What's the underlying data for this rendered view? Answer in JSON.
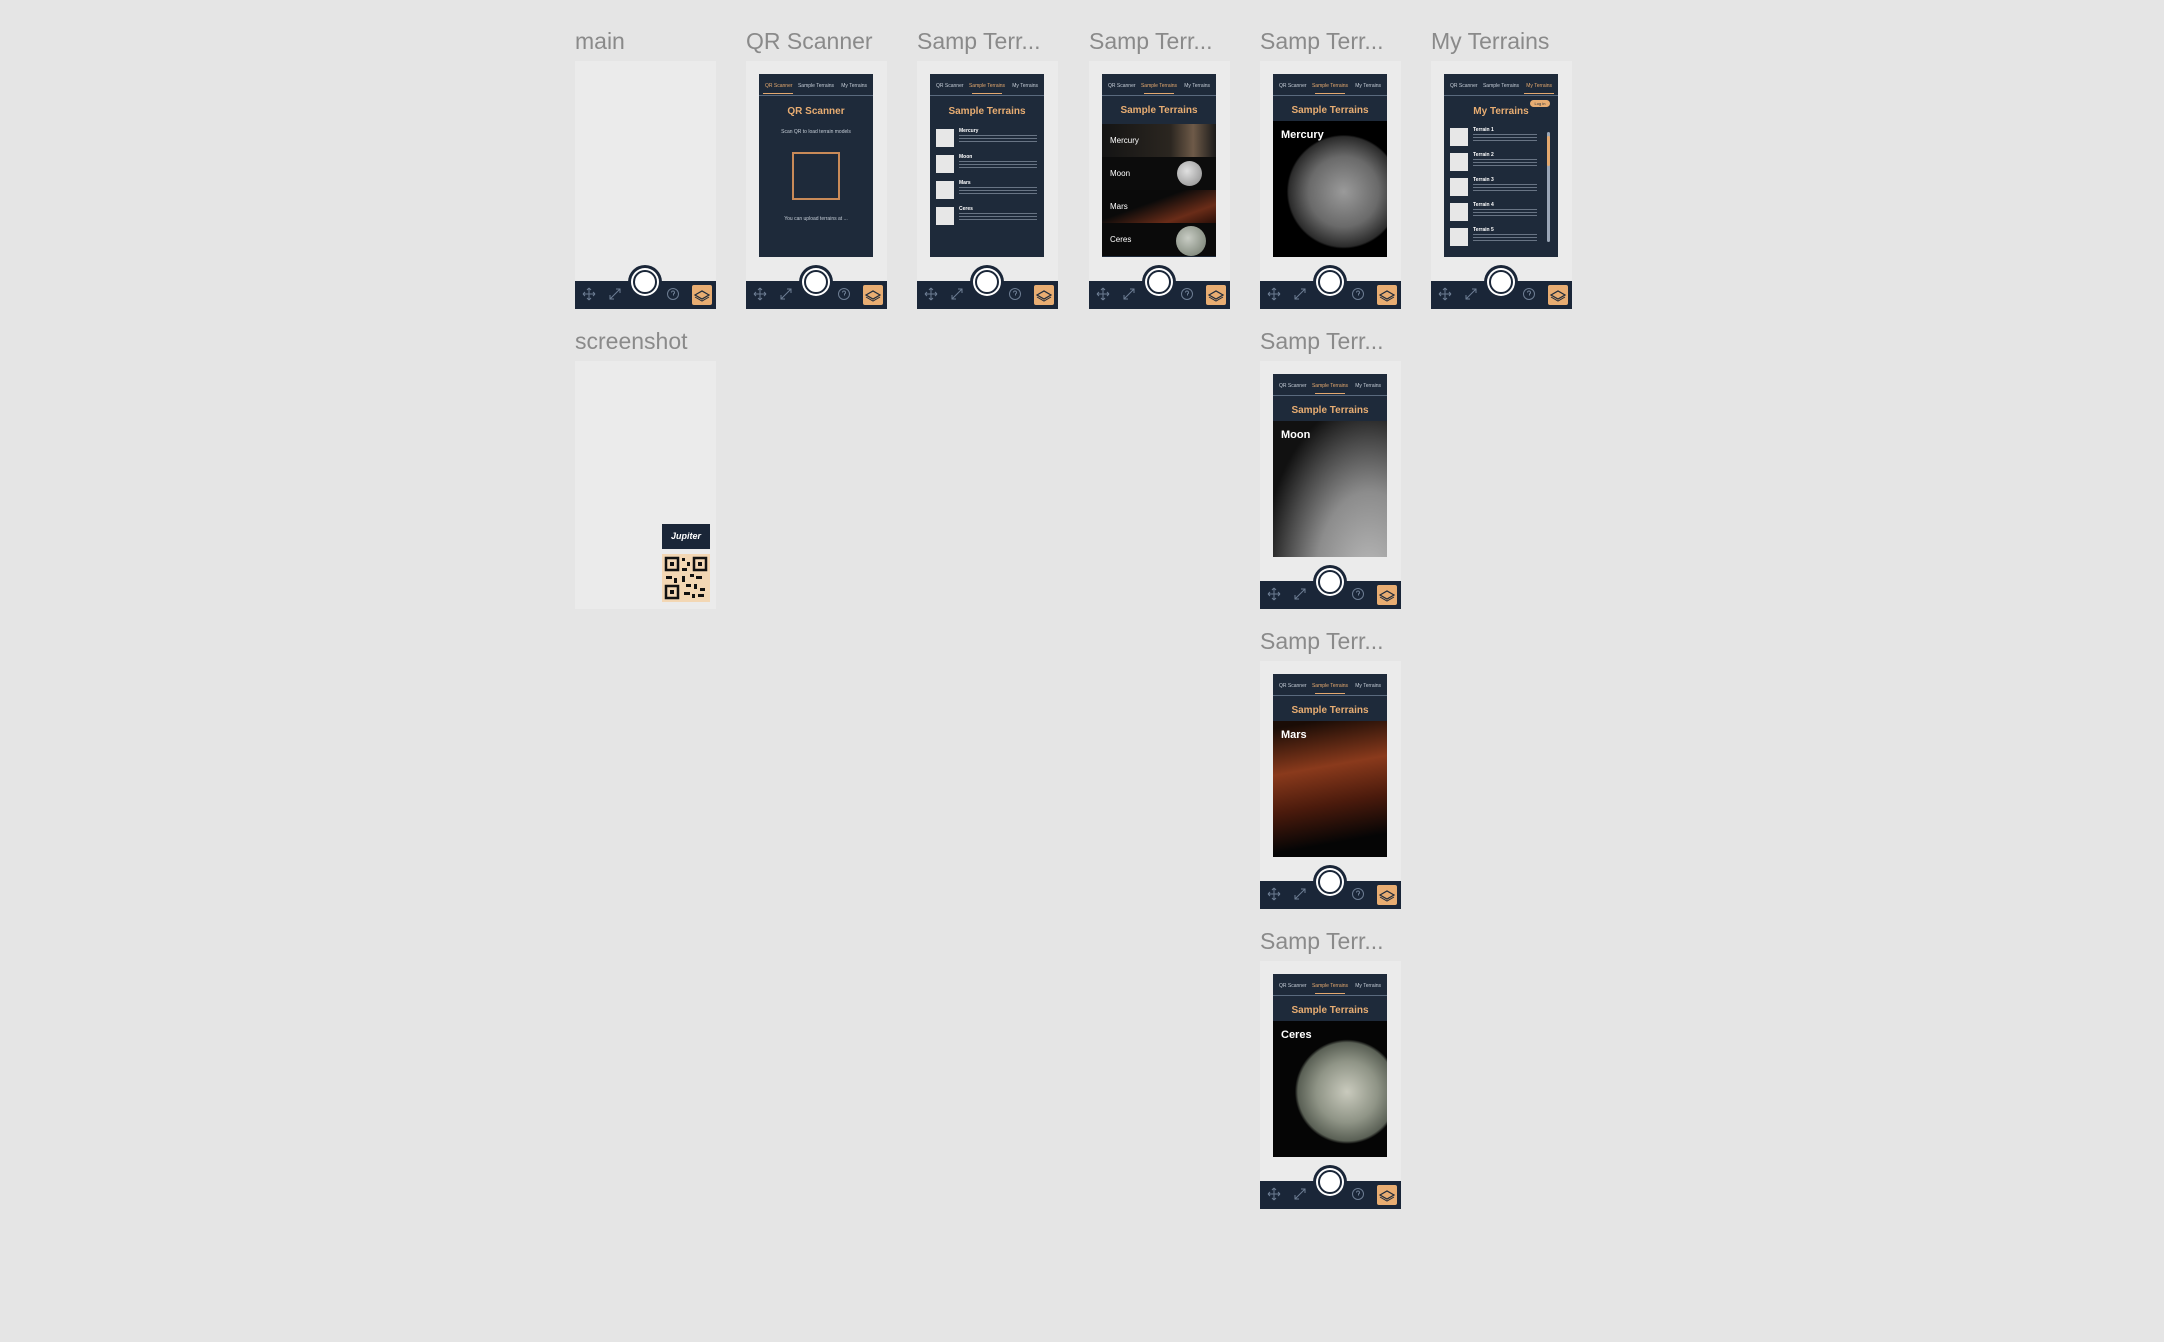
{
  "nav": {
    "qr": "QR Scanner",
    "sample": "Sample Terrains",
    "my": "My Terrains"
  },
  "tabs": [
    "Move",
    "Calibration",
    "Help"
  ],
  "frames": {
    "main": {
      "label": "main"
    },
    "qr": {
      "label": "QR Scanner",
      "heading": "QR Scanner",
      "instruction": "Scan QR to load terrain models",
      "footer": "You can upload terrains at ..."
    },
    "samp_list": {
      "label": "Samp Terr...",
      "heading": "Sample Terrains",
      "items": [
        "Mercury",
        "Moon",
        "Mars",
        "Ceres"
      ]
    },
    "samp_banners": {
      "label": "Samp Terr...",
      "heading": "Sample Terrains",
      "items": [
        "Mercury",
        "Moon",
        "Mars",
        "Ceres"
      ]
    },
    "samp_mercury": {
      "label": "Samp Terr...",
      "heading": "Sample Terrains",
      "title": "Mercury"
    },
    "my": {
      "label": "My Terrains",
      "heading": "My Terrains",
      "pill": "Log in",
      "items": [
        "Terrain 1",
        "Terrain 2",
        "Terrain 3",
        "Terrain 4",
        "Terrain 5"
      ]
    },
    "screenshot": {
      "label": "screenshot",
      "logo": "Jupiter"
    },
    "samp_moon": {
      "label": "Samp Terr...",
      "heading": "Sample Terrains",
      "title": "Moon"
    },
    "samp_mars": {
      "label": "Samp Terr...",
      "heading": "Sample Terrains",
      "title": "Mars"
    },
    "samp_ceres": {
      "label": "Samp Terr...",
      "heading": "Sample Terrains",
      "title": "Ceres"
    }
  },
  "colors": {
    "canvas": "#e5e5e5",
    "screen": "#1e2a3a",
    "accent": "#e8ad72",
    "label": "#8a8a8a"
  }
}
